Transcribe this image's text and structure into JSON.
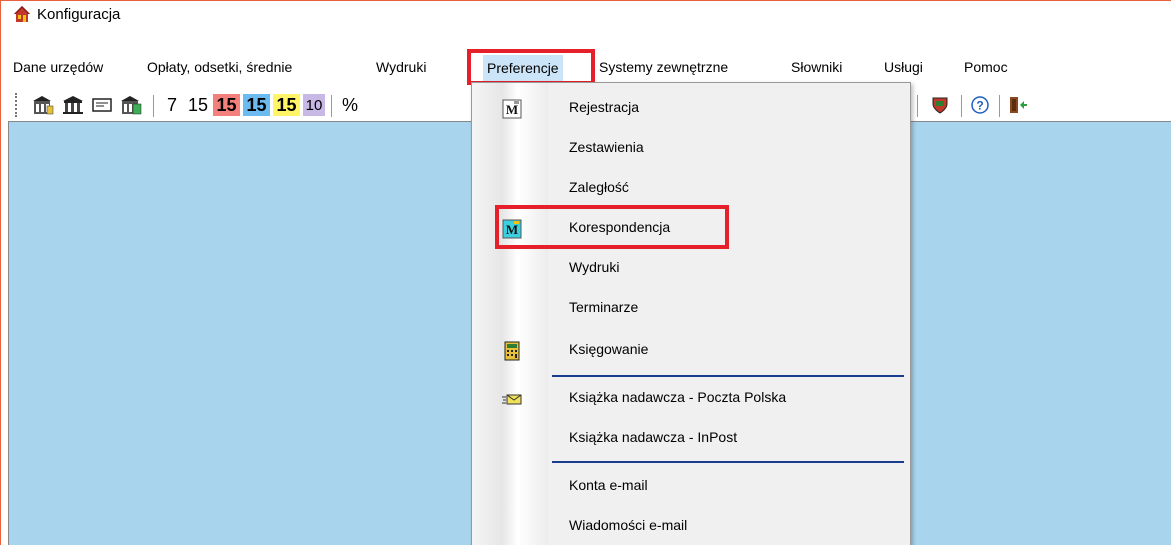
{
  "window": {
    "title": "Konfiguracja"
  },
  "menubar": {
    "items": [
      {
        "label": "Dane urzędów"
      },
      {
        "label": "Opłaty, odsetki, średnie"
      },
      {
        "label": "Wydruki"
      },
      {
        "label": "Preferencje"
      },
      {
        "label": "Systemy zewnętrzne"
      },
      {
        "label": "Słowniki"
      },
      {
        "label": "Usługi"
      },
      {
        "label": "Pomoc"
      }
    ],
    "active": "Preferencje"
  },
  "toolbar": {
    "numbers": [
      "7",
      "15",
      "15",
      "15",
      "15",
      "10"
    ],
    "percent": "%",
    "colors": {
      "red": "#f4807d",
      "blue": "#6cbbf0",
      "yellow": "#fff566",
      "purple": "#c7b8e6"
    }
  },
  "dropdown": {
    "items": [
      {
        "label": "Rejestracja",
        "icon": "m-letter-icon"
      },
      {
        "label": "Zestawienia",
        "icon": ""
      },
      {
        "label": "Zaległość",
        "icon": ""
      },
      {
        "label": "Korespondencja",
        "icon": "m-letter-highlight-icon"
      },
      {
        "label": "Wydruki",
        "icon": ""
      },
      {
        "label": "Terminarze",
        "icon": ""
      },
      {
        "label": "Księgowanie",
        "icon": "calculator-icon"
      },
      {
        "label": "Książka nadawcza - Poczta Polska",
        "icon": "envelope-icon"
      },
      {
        "label": "Książka nadawcza - InPost",
        "icon": ""
      },
      {
        "label": "Konta e-mail",
        "icon": ""
      },
      {
        "label": "Wiadomości e-mail",
        "icon": ""
      }
    ]
  },
  "colors": {
    "highlight": "#e5202a",
    "client_bg": "#a9d4ee",
    "title_border": "#e8613a"
  }
}
